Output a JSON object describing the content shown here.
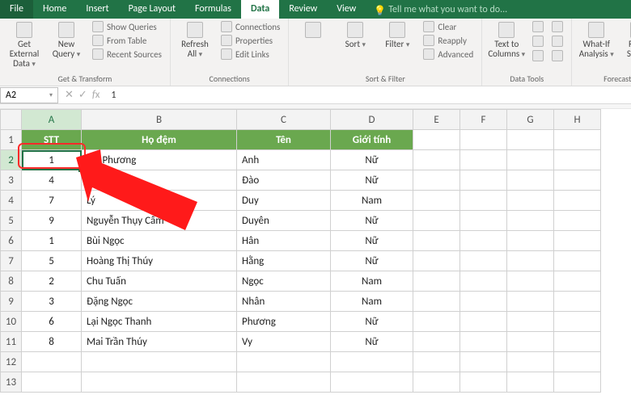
{
  "menu": {
    "file": "File",
    "items": [
      "Home",
      "Insert",
      "Page Layout",
      "Formulas",
      "Data",
      "Review",
      "View"
    ],
    "active_index": 4,
    "tell_me": "Tell me what you want to do..."
  },
  "ribbon": {
    "groups": [
      {
        "label": "Get & Transform",
        "big": [
          {
            "name": "get-external-data",
            "label": "Get External\nData"
          },
          {
            "name": "new-query",
            "label": "New\nQuery"
          }
        ],
        "small": [
          {
            "name": "show-queries",
            "label": "Show Queries"
          },
          {
            "name": "from-table",
            "label": "From Table"
          },
          {
            "name": "recent-sources",
            "label": "Recent Sources"
          }
        ]
      },
      {
        "label": "Connections",
        "big": [
          {
            "name": "refresh-all",
            "label": "Refresh\nAll"
          }
        ],
        "small": [
          {
            "name": "connections",
            "label": "Connections"
          },
          {
            "name": "properties",
            "label": "Properties"
          },
          {
            "name": "edit-links",
            "label": "Edit Links"
          }
        ]
      },
      {
        "label": "Sort & Filter",
        "big": [
          {
            "name": "sort-az",
            "label": ""
          },
          {
            "name": "sort",
            "label": "Sort"
          },
          {
            "name": "filter",
            "label": "Filter"
          }
        ],
        "small": [
          {
            "name": "clear",
            "label": "Clear"
          },
          {
            "name": "reapply",
            "label": "Reapply"
          },
          {
            "name": "advanced",
            "label": "Advanced"
          }
        ]
      },
      {
        "label": "Data Tools",
        "big": [
          {
            "name": "text-to-columns",
            "label": "Text to\nColumns"
          }
        ],
        "small": [
          {
            "name": "flash-fill",
            "label": ""
          },
          {
            "name": "remove-duplicates",
            "label": ""
          },
          {
            "name": "data-validation",
            "label": ""
          },
          {
            "name": "consolidate",
            "label": ""
          },
          {
            "name": "relationships",
            "label": ""
          },
          {
            "name": "manage-model",
            "label": ""
          }
        ]
      },
      {
        "label": "Forecast",
        "big": [
          {
            "name": "what-if",
            "label": "What-If\nAnalysis"
          },
          {
            "name": "forecast-sheet",
            "label": "Forec\nShee"
          }
        ]
      }
    ]
  },
  "formula_bar": {
    "name_box": "A2",
    "value": "1"
  },
  "columns": [
    "A",
    "B",
    "C",
    "D",
    "E",
    "F",
    "G",
    "H"
  ],
  "headers": {
    "stt": "STT",
    "hodem": "Họ đệm",
    "ten": "Tên",
    "gioitinh": "Giới tính"
  },
  "rows": [
    {
      "n": 2,
      "stt": "1",
      "hodem": "Phí Phương",
      "ten": "Anh",
      "gt": "Nữ"
    },
    {
      "n": 3,
      "stt": "4",
      "hodem": "Đào Hồng",
      "ten": "Đào",
      "gt": "Nữ"
    },
    {
      "n": 4,
      "stt": "7",
      "hodem": "Lý",
      "ten": "Duy",
      "gt": "Nam"
    },
    {
      "n": 5,
      "stt": "9",
      "hodem": "Nguyễn Thụy Cẩm",
      "ten": "Duyên",
      "gt": "Nữ"
    },
    {
      "n": 6,
      "stt": "1",
      "hodem": "Bùi Ngọc",
      "ten": "Hân",
      "gt": "Nữ"
    },
    {
      "n": 7,
      "stt": "5",
      "hodem": "Hoàng Thị Thúy",
      "ten": "Hằng",
      "gt": "Nữ"
    },
    {
      "n": 8,
      "stt": "2",
      "hodem": "Chu Tuấn",
      "ten": "Ngọc",
      "gt": "Nam"
    },
    {
      "n": 9,
      "stt": "3",
      "hodem": "Đặng Ngọc",
      "ten": "Nhân",
      "gt": "Nam"
    },
    {
      "n": 10,
      "stt": "6",
      "hodem": "Lại Ngọc Thanh",
      "ten": "Phương",
      "gt": "Nữ"
    },
    {
      "n": 11,
      "stt": "8",
      "hodem": "Mai Trần Thúy",
      "ten": "Vy",
      "gt": "Nữ"
    }
  ],
  "empty_rows": [
    12,
    13
  ],
  "selected_cell": {
    "row": 2,
    "col": "A"
  }
}
